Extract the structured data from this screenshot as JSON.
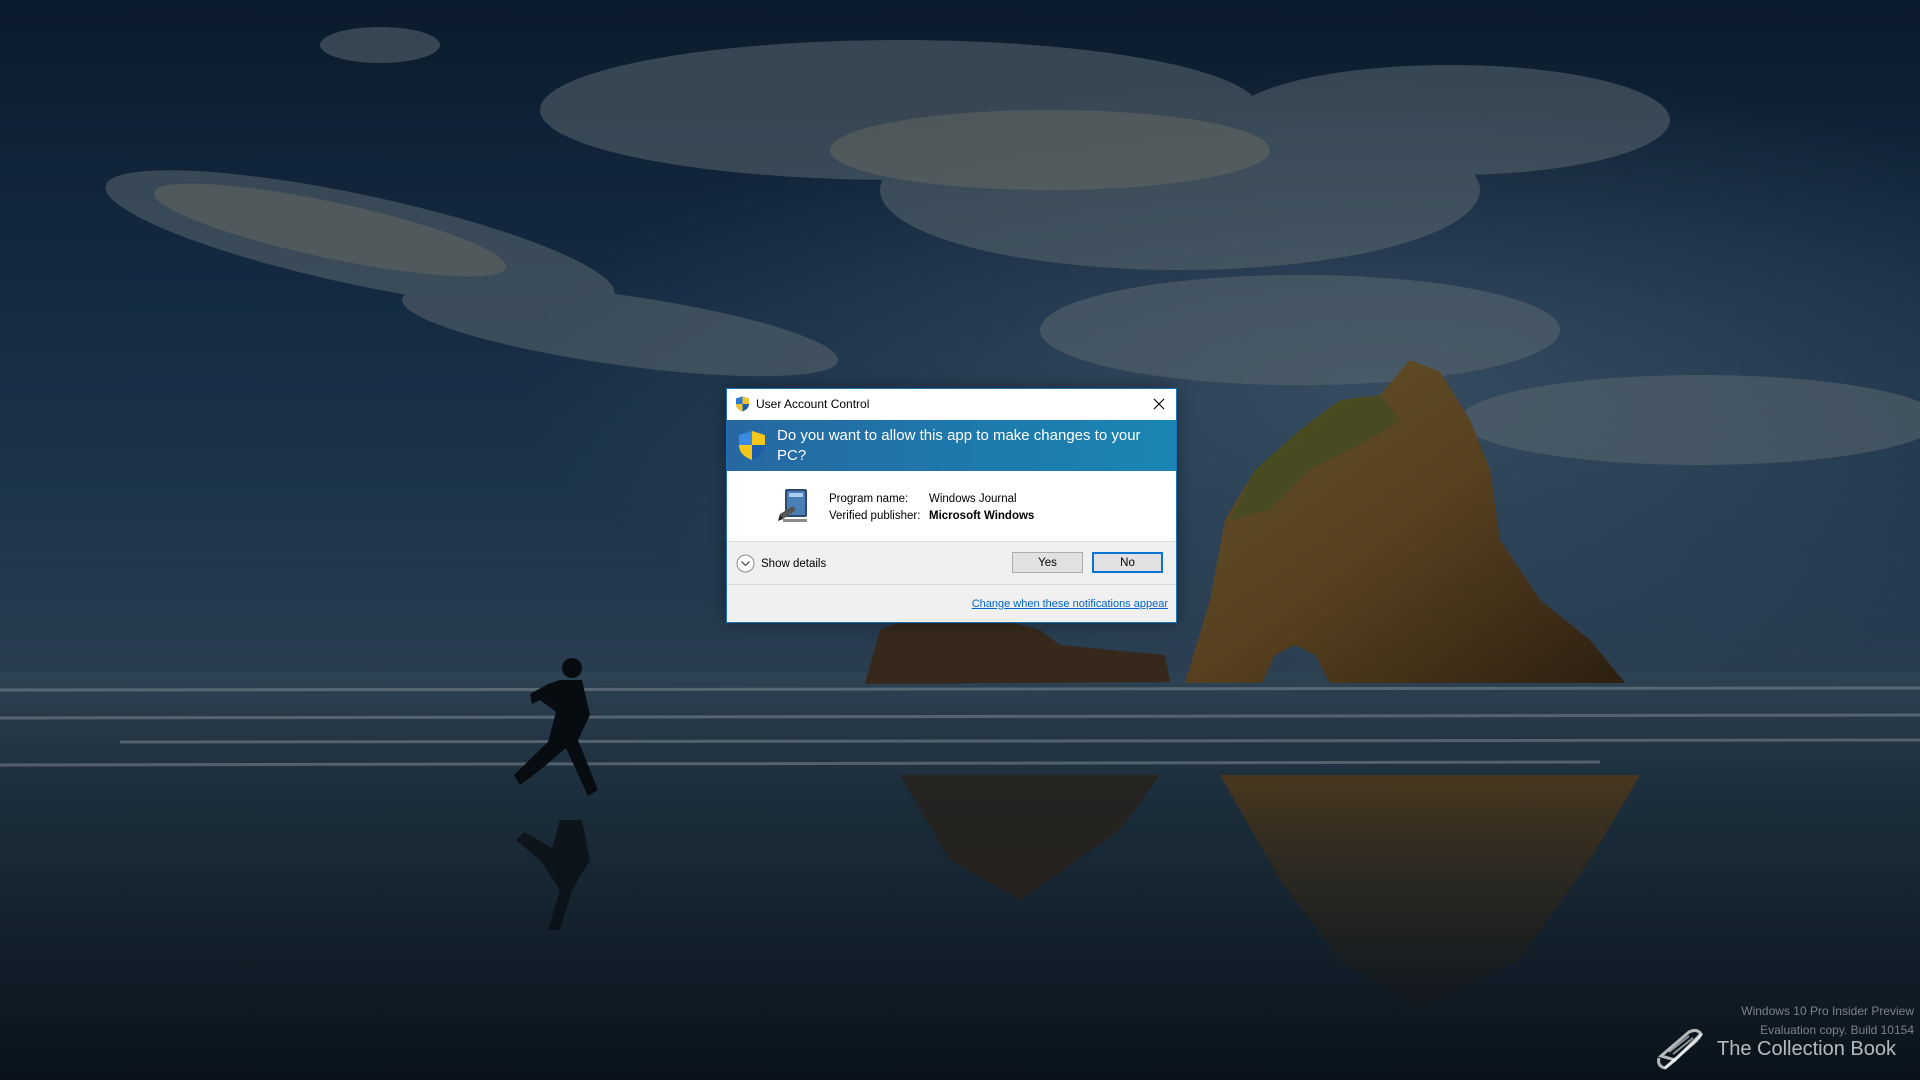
{
  "uac_dialog": {
    "title": "User Account Control",
    "question": "Do you want to allow this app to make changes to your PC?",
    "program_name_label": "Program name:",
    "program_name_value": "Windows Journal",
    "publisher_label": "Verified publisher:",
    "publisher_value": "Microsoft Windows",
    "show_details_label": "Show details",
    "yes_label": "Yes",
    "no_label": "No",
    "change_link": "Change when these notifications appear",
    "icons": {
      "title": "uac-shield-icon",
      "banner": "uac-shield-icon",
      "program": "windows-journal-icon",
      "close": "close-icon",
      "details": "chevron-down-icon"
    },
    "colors": {
      "banner": "#1f76ab",
      "link": "#0066cc",
      "default_button_border": "#0a74d6"
    }
  },
  "watermark": {
    "line1": "Windows 10 Pro Insider Preview",
    "line2": "Evaluation copy. Build 10154"
  },
  "brand": {
    "name": "The Collection Book",
    "icon": "book-icon"
  }
}
